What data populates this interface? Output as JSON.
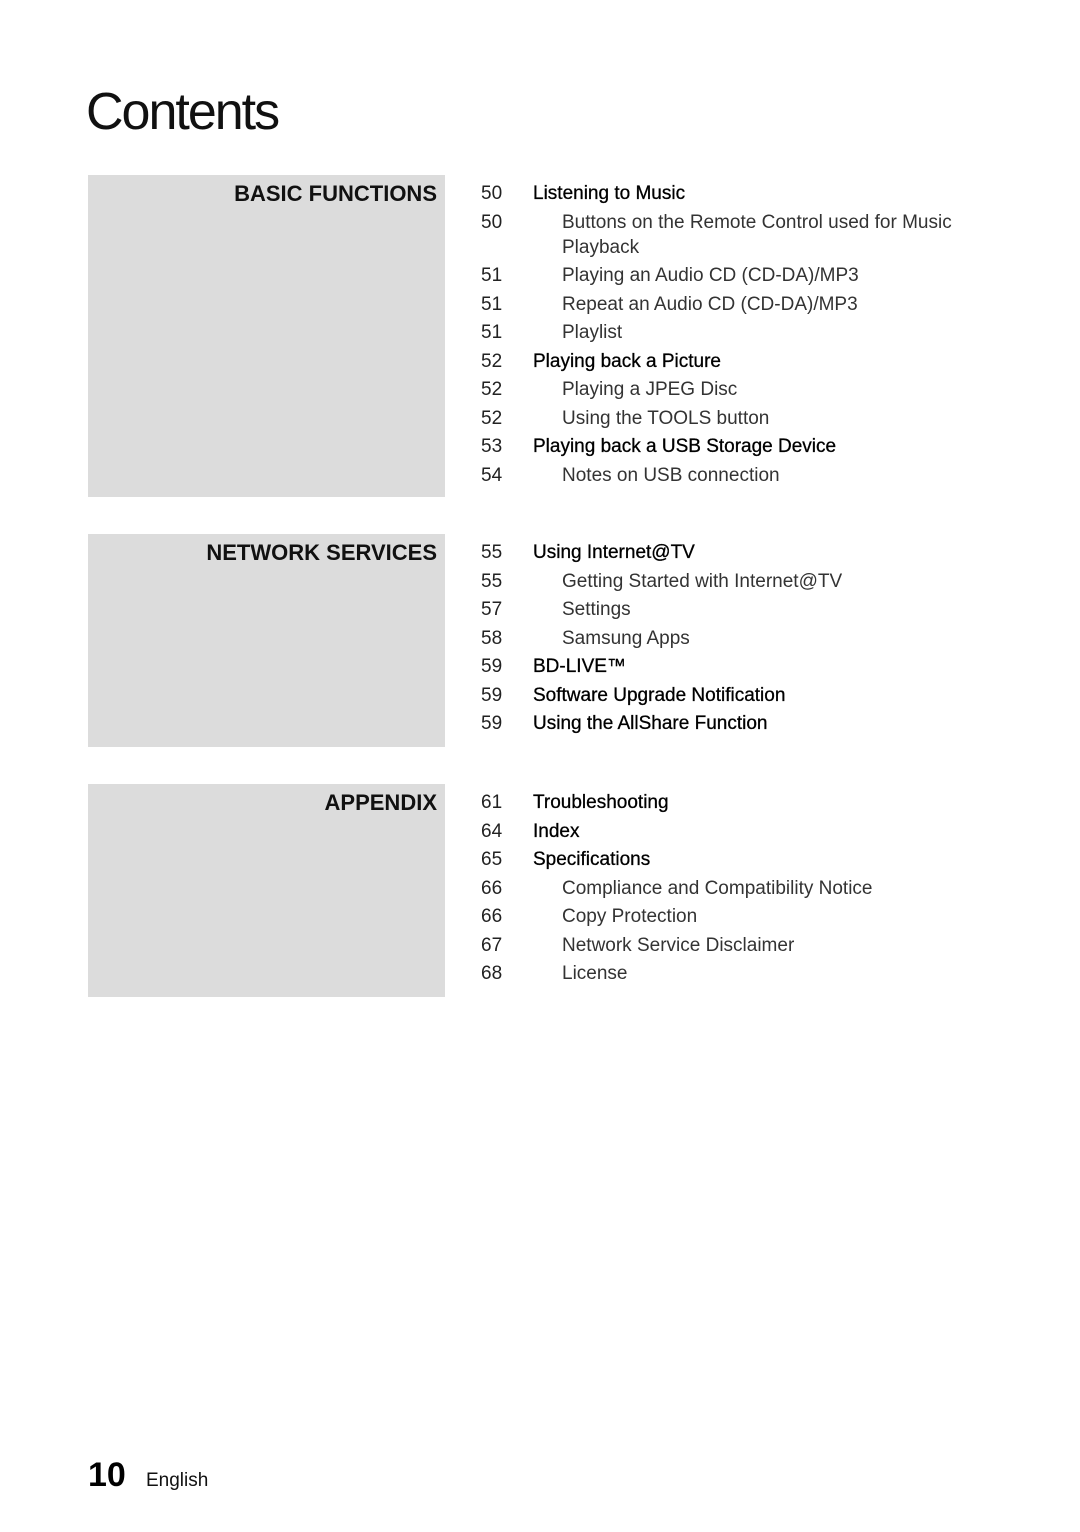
{
  "page_title": "Contents",
  "sections": [
    {
      "label": "BASIC FUNCTIONS",
      "entries": [
        {
          "page": "50",
          "text": "Listening to Music",
          "level": "major"
        },
        {
          "page": "50",
          "text": "Buttons on the Remote Control used for Music Playback",
          "level": "minor"
        },
        {
          "page": "51",
          "text": "Playing an Audio CD (CD-DA)/MP3",
          "level": "minor"
        },
        {
          "page": "51",
          "text": "Repeat an Audio CD (CD-DA)/MP3",
          "level": "minor"
        },
        {
          "page": "51",
          "text": "Playlist",
          "level": "minor"
        },
        {
          "page": "52",
          "text": "Playing back a Picture",
          "level": "major"
        },
        {
          "page": "52",
          "text": "Playing a JPEG Disc",
          "level": "minor"
        },
        {
          "page": "52",
          "text": "Using the TOOLS button",
          "level": "minor"
        },
        {
          "page": "53",
          "text": "Playing back a USB Storage Device",
          "level": "major"
        },
        {
          "page": "54",
          "text": "Notes on USB connection",
          "level": "minor"
        }
      ]
    },
    {
      "label": "NETWORK SERVICES",
      "entries": [
        {
          "page": "55",
          "text": "Using Internet@TV",
          "level": "major"
        },
        {
          "page": "55",
          "text": "Getting Started with Internet@TV",
          "level": "minor"
        },
        {
          "page": "57",
          "text": "Settings",
          "level": "minor"
        },
        {
          "page": "58",
          "text": "Samsung Apps",
          "level": "minor"
        },
        {
          "page": "59",
          "text": "BD-LIVE™",
          "level": "major"
        },
        {
          "page": "59",
          "text": "Software Upgrade Notification",
          "level": "major"
        },
        {
          "page": "59",
          "text": "Using the AllShare Function",
          "level": "major"
        }
      ]
    },
    {
      "label": "APPENDIX",
      "entries": [
        {
          "page": "61",
          "text": "Troubleshooting",
          "level": "major"
        },
        {
          "page": "64",
          "text": "Index",
          "level": "major"
        },
        {
          "page": "65",
          "text": "Specifications",
          "level": "major"
        },
        {
          "page": "66",
          "text": "Compliance and Compatibility Notice",
          "level": "minor"
        },
        {
          "page": "66",
          "text": "Copy Protection",
          "level": "minor"
        },
        {
          "page": "67",
          "text": "Network Service Disclaimer",
          "level": "minor"
        },
        {
          "page": "68",
          "text": "License",
          "level": "minor"
        }
      ]
    }
  ],
  "footer": {
    "page_number": "10",
    "language": "English"
  }
}
